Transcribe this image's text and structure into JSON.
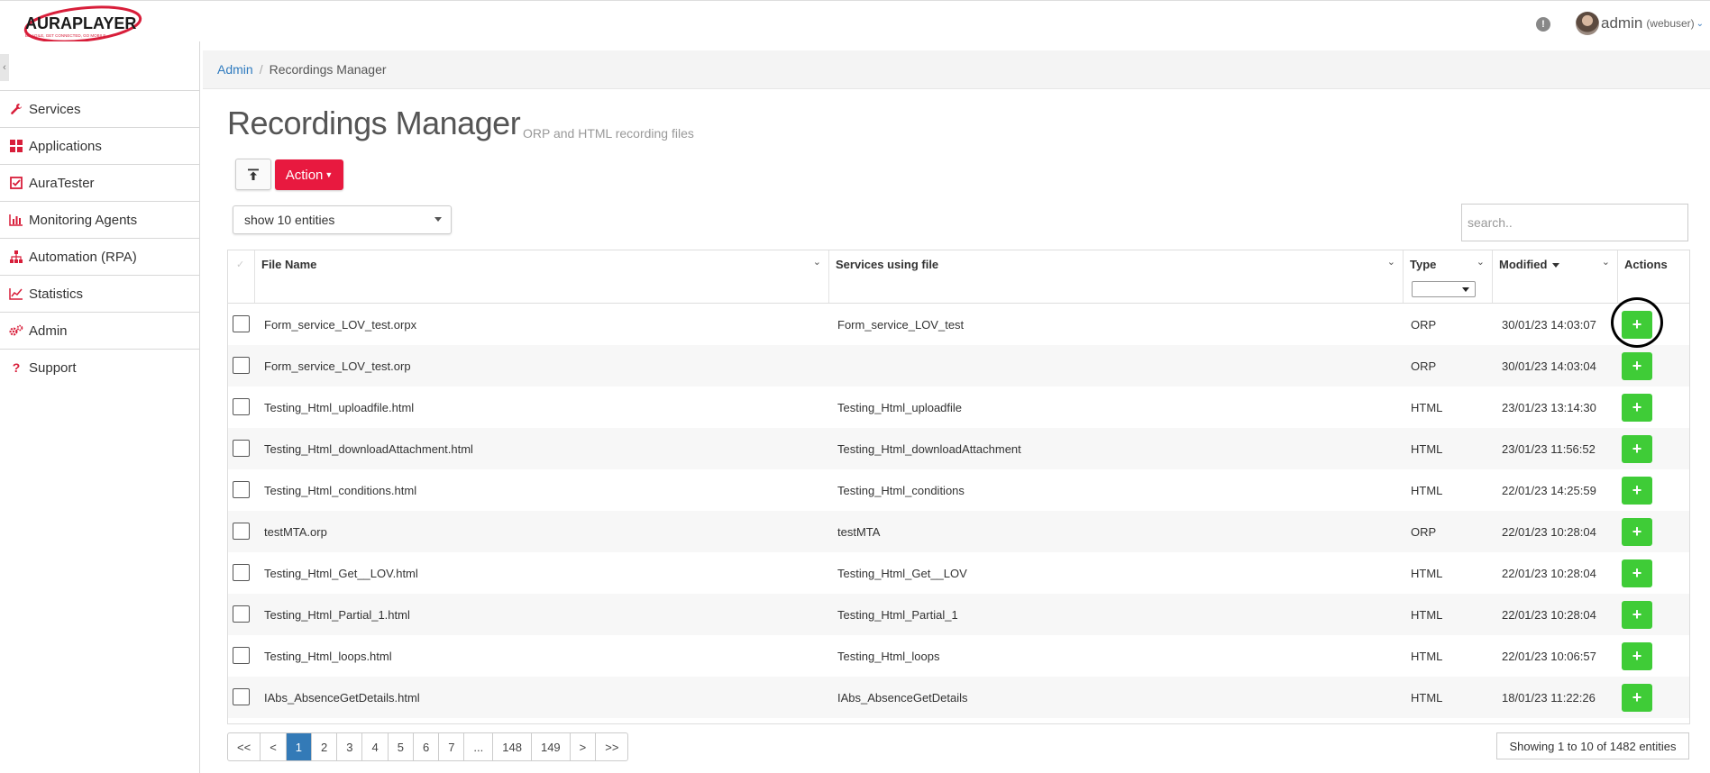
{
  "header": {
    "logo_text": "AURAPLAYER",
    "logo_tagline": "BE AGILE, GET CONNECTED, GO MOBILE",
    "alert_glyph": "!",
    "user_name": "admin",
    "user_role": "(webuser)"
  },
  "sidebar": {
    "items": [
      {
        "label": "Services",
        "icon": "wrench-icon"
      },
      {
        "label": "Applications",
        "icon": "apps-grid-icon"
      },
      {
        "label": "AuraTester",
        "icon": "check-square-icon"
      },
      {
        "label": "Monitoring Agents",
        "icon": "bar-chart-icon"
      },
      {
        "label": "Automation (RPA)",
        "icon": "sitemap-icon"
      },
      {
        "label": "Statistics",
        "icon": "line-chart-icon"
      },
      {
        "label": "Admin",
        "icon": "gears-icon"
      },
      {
        "label": "Support",
        "icon": "question-icon"
      }
    ]
  },
  "breadcrumb": {
    "root": "Admin",
    "separator": "/",
    "current": "Recordings Manager"
  },
  "page": {
    "title": "Recordings Manager",
    "subtitle": "ORP and HTML recording files",
    "action_label": "Action",
    "entities_select": "show 10 entities",
    "search_placeholder": "search.."
  },
  "table": {
    "columns": {
      "file_name": "File Name",
      "services": "Services using file",
      "type": "Type",
      "modified": "Modified",
      "actions": "Actions"
    },
    "rows": [
      {
        "file": "Form_service_LOV_test.orpx",
        "service": "Form_service_LOV_test",
        "type": "ORP",
        "modified": "30/01/23 14:03:07"
      },
      {
        "file": "Form_service_LOV_test.orp",
        "service": "",
        "type": "ORP",
        "modified": "30/01/23 14:03:04"
      },
      {
        "file": "Testing_Html_uploadfile.html",
        "service": "Testing_Html_uploadfile",
        "type": "HTML",
        "modified": "23/01/23 13:14:30"
      },
      {
        "file": "Testing_Html_downloadAttachment.html",
        "service": "Testing_Html_downloadAttachment",
        "type": "HTML",
        "modified": "23/01/23 11:56:52"
      },
      {
        "file": "Testing_Html_conditions.html",
        "service": "Testing_Html_conditions",
        "type": "HTML",
        "modified": "22/01/23 14:25:59"
      },
      {
        "file": "testMTA.orp",
        "service": "testMTA",
        "type": "ORP",
        "modified": "22/01/23 10:28:04"
      },
      {
        "file": "Testing_Html_Get__LOV.html",
        "service": "Testing_Html_Get__LOV",
        "type": "HTML",
        "modified": "22/01/23 10:28:04"
      },
      {
        "file": "Testing_Html_Partial_1.html",
        "service": "Testing_Html_Partial_1",
        "type": "HTML",
        "modified": "22/01/23 10:28:04"
      },
      {
        "file": "Testing_Html_loops.html",
        "service": "Testing_Html_loops",
        "type": "HTML",
        "modified": "22/01/23 10:06:57"
      },
      {
        "file": "IAbs_AbsenceGetDetails.html",
        "service": "IAbs_AbsenceGetDetails",
        "type": "HTML",
        "modified": "18/01/23 11:22:26"
      }
    ]
  },
  "pagination": {
    "pages": [
      "<<",
      "<",
      "1",
      "2",
      "3",
      "4",
      "5",
      "6",
      "7",
      "...",
      "148",
      "149",
      ">",
      ">>"
    ],
    "active": "1",
    "summary": "Showing 1 to 10 of 1482 entities"
  },
  "colors": {
    "brand_red": "#e8193f",
    "add_green": "#3fcc37",
    "link_blue": "#2f7bbf",
    "active_page": "#337ab7"
  }
}
